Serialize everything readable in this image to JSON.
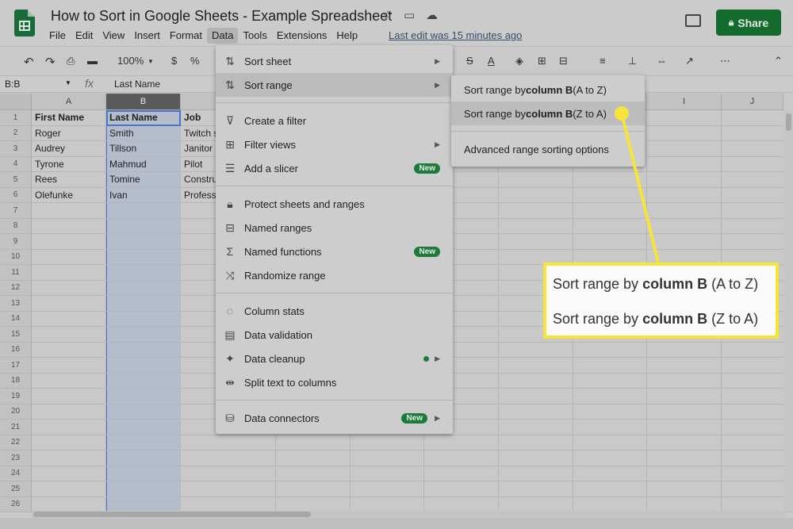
{
  "header": {
    "title": "How to Sort in Google Sheets - Example Spreadsheet",
    "menu": [
      "File",
      "Edit",
      "View",
      "Insert",
      "Format",
      "Data",
      "Tools",
      "Extensions",
      "Help"
    ],
    "last_edit": "Last edit was 15 minutes ago",
    "share_label": "Share",
    "icons": [
      "sheets-logo-icon",
      "star-icon",
      "move-folder-icon",
      "cloud-icon",
      "comments-icon",
      "lock-icon"
    ]
  },
  "toolbar": {
    "zoom": "100%",
    "currency": "$",
    "percent": "%",
    "more": "⋯"
  },
  "formula_bar": {
    "name_box": "B:B",
    "fx": "fx",
    "value": "Last Name"
  },
  "grid": {
    "columns": [
      "A",
      "B",
      "C",
      "D",
      "E",
      "F",
      "G",
      "H",
      "I",
      "J"
    ],
    "selected_column": "B",
    "rows": [
      "1",
      "2",
      "3",
      "4",
      "5",
      "6",
      "7",
      "8",
      "9",
      "10",
      "11",
      "12",
      "13",
      "14",
      "15",
      "16",
      "17",
      "18",
      "19",
      "20",
      "21",
      "22",
      "23",
      "24",
      "25",
      "26"
    ],
    "headers": [
      "First Name",
      "Last Name",
      "Job"
    ],
    "data": [
      [
        "Roger",
        "Smith",
        "Twitch s"
      ],
      [
        "Audrey",
        "Tillson",
        "Janitor"
      ],
      [
        "Tyrone",
        "Mahmud",
        "Pilot"
      ],
      [
        "Rees",
        "Tomine",
        "Constru"
      ],
      [
        "Olefunke",
        "Ivan",
        "Profess"
      ]
    ]
  },
  "data_menu": {
    "items": [
      {
        "label": "Sort sheet",
        "icon": "sort-icon",
        "arrow": true
      },
      {
        "label": "Sort range",
        "icon": "sort-range-icon",
        "arrow": true,
        "highlighted": true
      },
      {
        "label": "Create a filter",
        "icon": "filter-icon"
      },
      {
        "label": "Filter views",
        "icon": "filter-views-icon",
        "arrow": true
      },
      {
        "label": "Add a slicer",
        "icon": "slicer-icon",
        "badge": "New"
      },
      {
        "label": "Protect sheets and ranges",
        "icon": "lock-icon"
      },
      {
        "label": "Named ranges",
        "icon": "named-ranges-icon"
      },
      {
        "label": "Named functions",
        "icon": "sigma-icon",
        "badge": "New"
      },
      {
        "label": "Randomize range",
        "icon": "shuffle-icon"
      },
      {
        "label": "Column stats",
        "icon": "lightbulb-icon"
      },
      {
        "label": "Data validation",
        "icon": "data-validation-icon"
      },
      {
        "label": "Data cleanup",
        "icon": "magic-wand-icon",
        "arrow": true
      },
      {
        "label": "Split text to columns",
        "icon": "split-icon"
      },
      {
        "label": "Data connectors",
        "icon": "database-icon",
        "badge": "New",
        "arrow": true
      }
    ]
  },
  "submenu": {
    "a_to_z": {
      "pre": "Sort range by ",
      "bold": "column B",
      "post": " (A to Z)"
    },
    "z_to_a": {
      "pre": "Sort range by ",
      "bold": "column B",
      "post": " (Z to A)"
    },
    "advanced": "Advanced range sorting options"
  },
  "callout": {
    "line1": {
      "pre": "Sort range by ",
      "bold": "column B",
      "post": " (A to Z)"
    },
    "line2": {
      "pre": "Sort range by ",
      "bold": "column B",
      "post": " (Z to A)"
    },
    "color": "#f6e43a"
  }
}
